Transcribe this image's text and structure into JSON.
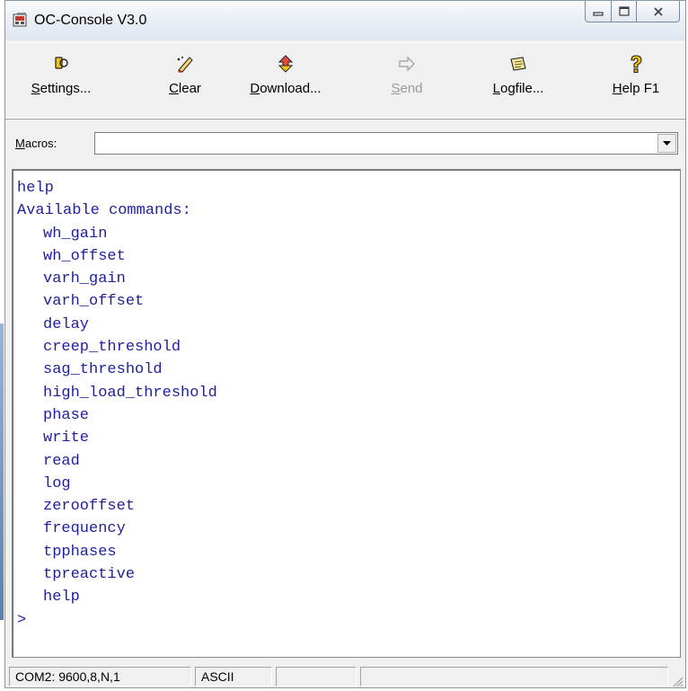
{
  "window": {
    "title": "OC-Console V3.0"
  },
  "toolbar": {
    "settings": {
      "label_u": "S",
      "label_rest": "ettings...",
      "icon": "settings-icon"
    },
    "clear": {
      "label_u": "C",
      "label_rest": "lear",
      "icon": "eraser-icon"
    },
    "download": {
      "label_u": "D",
      "label_rest": "ownload...",
      "icon": "download-icon"
    },
    "send": {
      "label_u": "S",
      "label_rest": "end",
      "icon": "arrow-right-icon",
      "disabled": true
    },
    "logfile": {
      "label_u": "L",
      "label_rest": "ogfile...",
      "icon": "logfile-icon"
    },
    "help": {
      "label_u": "H",
      "label_rest": "elp F1",
      "icon": "help-icon"
    }
  },
  "macros": {
    "label_u": "M",
    "label_rest": "acros:",
    "value": ""
  },
  "console": {
    "header": [
      "help",
      "Available commands:"
    ],
    "commands": [
      "wh_gain",
      "wh_offset",
      "varh_gain",
      "varh_offset",
      "delay",
      "creep_threshold",
      "sag_threshold",
      "high_load_threshold",
      "phase",
      "write",
      "read",
      "log",
      "zerooffset",
      "frequency",
      "tpphases",
      "tpreactive",
      "help"
    ],
    "prompt": ">"
  },
  "statusbar": {
    "port": "COM2: 9600,8,N,1",
    "encoding": "ASCII",
    "panel3": "",
    "panel4": ""
  },
  "colors": {
    "console_text": "#1f1f9e",
    "window_bg": "#f0f0f0"
  }
}
